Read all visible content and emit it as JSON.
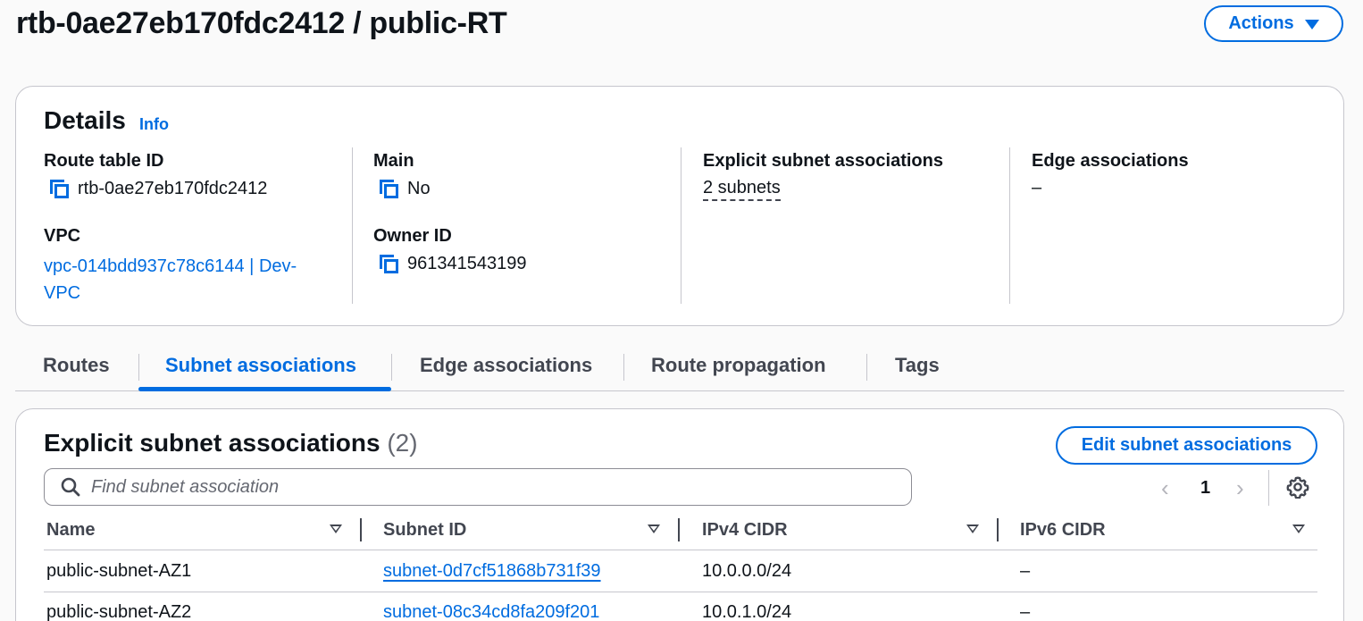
{
  "page": {
    "title": "rtb-0ae27eb170fdc2412 / public-RT",
    "actions_label": "Actions"
  },
  "details": {
    "heading": "Details",
    "info_label": "Info",
    "route_table_id_label": "Route table ID",
    "route_table_id_value": "rtb-0ae27eb170fdc2412",
    "main_label": "Main",
    "main_value": "No",
    "explicit_label": "Explicit subnet associations",
    "explicit_value": "2 subnets",
    "edge_label": "Edge associations",
    "edge_value": "–",
    "vpc_label": "VPC",
    "vpc_value_line1": "vpc-014bdd937c78c6144 | Dev-",
    "vpc_value_line2": "VPC",
    "owner_label": "Owner ID",
    "owner_value": "961341543199"
  },
  "tabs": [
    {
      "label": "Routes",
      "active": false
    },
    {
      "label": "Subnet associations",
      "active": true
    },
    {
      "label": "Edge associations",
      "active": false
    },
    {
      "label": "Route propagation",
      "active": false
    },
    {
      "label": "Tags",
      "active": false
    }
  ],
  "associations": {
    "heading": "Explicit subnet associations",
    "count": "(2)",
    "edit_label": "Edit subnet associations",
    "search_placeholder": "Find subnet association",
    "page_number": "1",
    "columns": [
      "Name",
      "Subnet ID",
      "IPv4 CIDR",
      "IPv6 CIDR"
    ],
    "rows": [
      {
        "name": "public-subnet-AZ1",
        "subnet_id": "subnet-0d7cf51868b731f39",
        "ipv4": "10.0.0.0/24",
        "ipv6": "–"
      },
      {
        "name": "public-subnet-AZ2",
        "subnet_id": "subnet-08c34cd8fa209f201",
        "ipv4": "10.0.1.0/24",
        "ipv6": "–"
      }
    ]
  },
  "colors": {
    "accent": "#006ce0",
    "text": "#0f141a",
    "border": "#c6c6cd"
  },
  "icons": [
    "copy-icon",
    "caret-down-icon",
    "search-icon",
    "chevron-left-icon",
    "chevron-right-icon",
    "gear-icon",
    "sort-icon"
  ]
}
